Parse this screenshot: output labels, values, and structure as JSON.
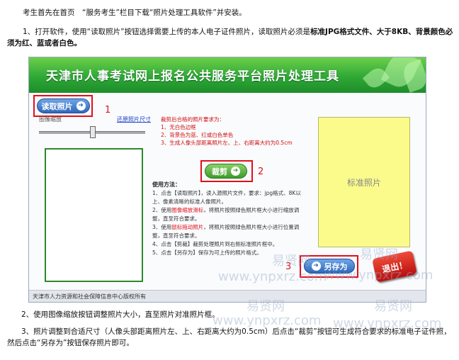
{
  "intro": "考生首先在首页　“服务考生”栏目下载“照片处理工具软件”并安装。",
  "step1": {
    "lead": "1、打开软件，使用“读取照片”按钮选择需要上传的本人电子证件照片，读取照片必须是",
    "bold": "标准JPG格式文件、大于8KB、背景颜色必须为红、蓝或者白色。"
  },
  "app": {
    "title": "天津市人事考试网上报名公共服务平台照片处理工具",
    "read_button": "读取照片",
    "crop_button": "裁剪",
    "save_button": "另存为",
    "exit_button": "退出！",
    "zoom_label": "图像缩放",
    "restore_link": "还原照片尺寸",
    "std_photo_label": "标准照片",
    "requirements": {
      "title": "裁剪后合格的照片要求为：",
      "items": [
        "1、无白色边框",
        "2、背景色为蓝、红或白色单色",
        "3、生成人像头部距离照片左、上、右距离大约为0.5cm"
      ]
    },
    "usage": {
      "title": "使用方法：",
      "i1": "1、点击【读取照片】，读入源照片文件，要求：jpg格式、8K以上、像素清晰的标准人像照片。",
      "i2a": "2、使用",
      "i2b": "图像缩放滑标",
      "i2c": "，将照片按照绿色照片框大小进行缩放调整，直至符合要求。",
      "i3a": "3、使用",
      "i3b": "鼠标拖动照片",
      "i3c": "，将照片按照绿色照片框大小进行位置调整，直至符合要求。",
      "i4": "4、点击【剪裁】裁剪处理照片到右侧标准照片框中。",
      "i5": "5、点击【另存为】保存为可上传的照片格式。"
    },
    "footer": "天津市人力资源和社会保障信息中心版权所有",
    "zoom_level": 0.5
  },
  "markers": [
    "1",
    "2",
    "3"
  ],
  "watermarks": [
    "易贤网",
    "易贤网",
    "www.ynpxrz.com",
    "www.ynpxrz.com",
    "易贤网",
    "易贤网",
    "www.ynpxrz.com",
    "www.ynpxrz.com"
  ],
  "step2": "2、使用图像缩放按钮调整照片大小，直至照片对准照片框。",
  "step3": "3、照片调整到合适尺寸（人像头部距离照片左、上、右距离大约为0.5cm）后点击“裁剪”按钮可生成符合要求的标准电子证件照，然后点击“另存为”按钮保存照片即可。"
}
